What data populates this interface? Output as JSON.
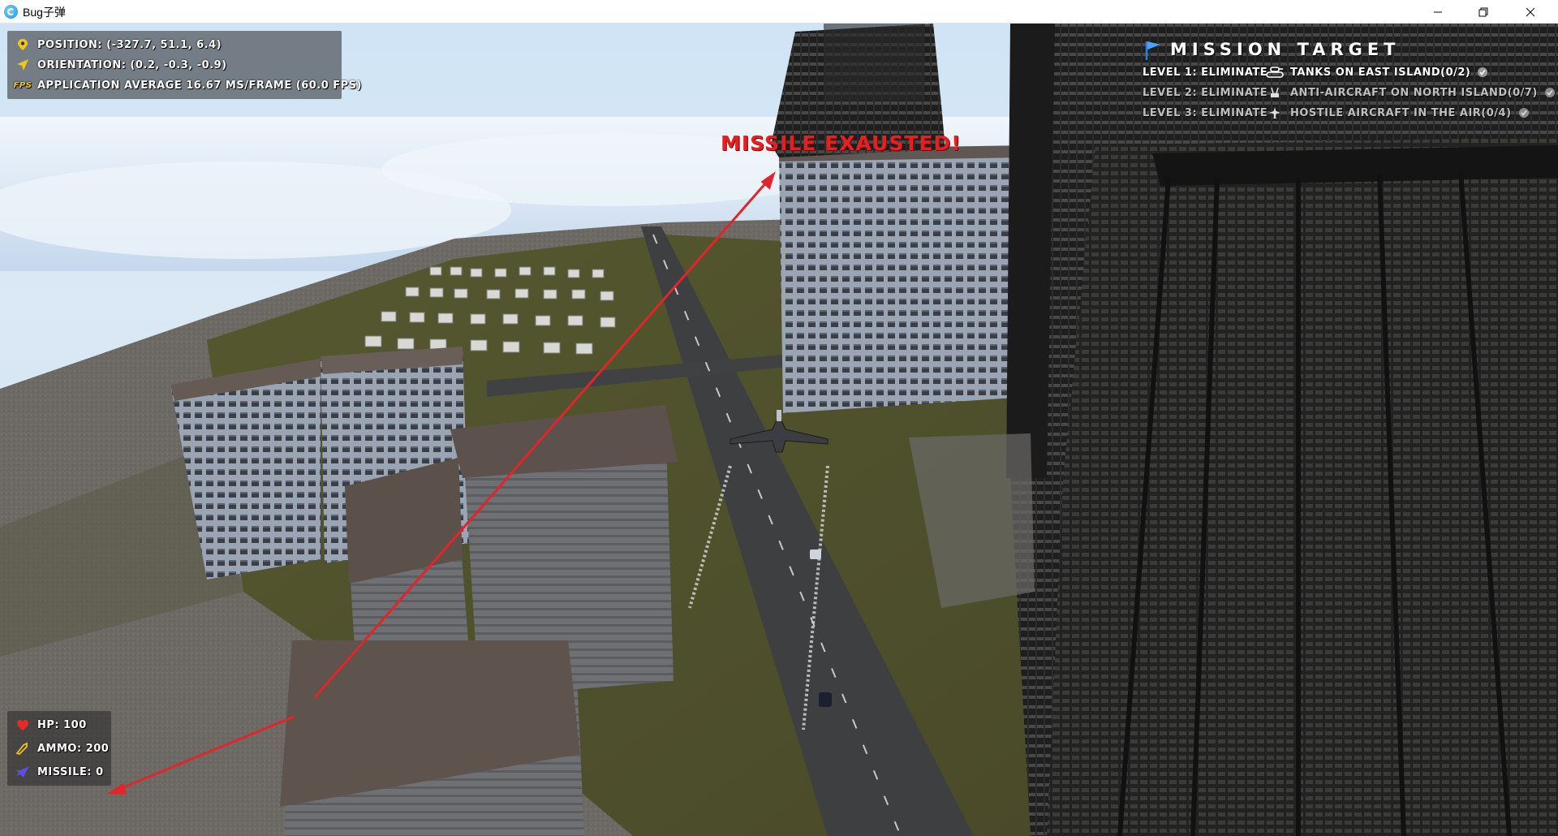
{
  "window": {
    "title": "Bug子弹",
    "minimize_icon": "minimize-icon",
    "maximize_icon": "restore-icon",
    "close_icon": "close-icon"
  },
  "telemetry": {
    "position": "Position: (-327.7, 51.1, 6.4)",
    "orientation": "Orientation: (0.2, -0.3, -0.9)",
    "fps_badge": "FPS",
    "fps": "Application average 16.67 ms/frame (60.0 FPS)"
  },
  "mission": {
    "title": "MISSION  TARGET",
    "levels": [
      {
        "level": "Level 1: Eliminate",
        "target": "Tanks on East Island(0/2)",
        "icon": "tank-icon",
        "active": true
      },
      {
        "level": "Level 2: Eliminate",
        "target": "Anti-Aircraft on North Island(0/7)",
        "icon": "anti-aircraft-icon",
        "active": false
      },
      {
        "level": "Level 3: Eliminate",
        "target": "Hostile Aircraft in the Air(0/4)",
        "icon": "aircraft-icon",
        "active": false
      }
    ]
  },
  "warning": "MISSILE EXAUSTED!",
  "status": {
    "hp": "HP: 100",
    "ammo": "AMMO: 200",
    "missile": "MISSILE: 0",
    "health_fraction": 1.0
  },
  "colors": {
    "warning_red": "#e52020",
    "annotation_arrow": "#e0252b",
    "hud_text": "#ffffff",
    "health_bar": "#22cc22"
  }
}
